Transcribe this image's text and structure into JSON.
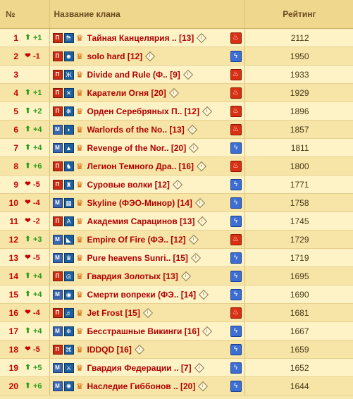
{
  "header": {
    "num": "№",
    "name": "Название клана",
    "rating": "Рейтинг"
  },
  "colors": {
    "rank": "#c40000",
    "up": "#2a9b1a",
    "down": "#c40000",
    "fire": "#d92f12",
    "storm": "#3c6ed6"
  },
  "rows": [
    {
      "place": "1",
      "dir": "up",
      "change": "+1",
      "badge": "П",
      "emblem": "⛈",
      "name": "Тайная Канцелярия .. [13]",
      "element": "fire",
      "rating": "2112"
    },
    {
      "place": "2",
      "dir": "down",
      "change": "-1",
      "badge": "П",
      "emblem": "☻",
      "name": "solo hard [12]",
      "element": "storm",
      "rating": "1950"
    },
    {
      "place": "3",
      "dir": "none",
      "change": "",
      "badge": "П",
      "emblem": "Ж",
      "name": "Divide and Rule (Ф.. [9]",
      "element": "fire",
      "rating": "1933"
    },
    {
      "place": "4",
      "dir": "up",
      "change": "+1",
      "badge": "П",
      "emblem": "✕",
      "name": "Каратели Огня [20]",
      "element": "fire",
      "rating": "1929"
    },
    {
      "place": "5",
      "dir": "up",
      "change": "+2",
      "badge": "П",
      "emblem": "❋",
      "name": "Орден Серебряных П.. [12]",
      "element": "fire",
      "rating": "1896"
    },
    {
      "place": "6",
      "dir": "up",
      "change": "+4",
      "badge": "М",
      "emblem": "◗",
      "name": "Warlords of the No.. [13]",
      "element": "fire",
      "rating": "1857"
    },
    {
      "place": "7",
      "dir": "up",
      "change": "+4",
      "badge": "М",
      "emblem": "▲",
      "name": "Revenge of the Nor.. [20]",
      "element": "storm",
      "rating": "1811"
    },
    {
      "place": "8",
      "dir": "up",
      "change": "+6",
      "badge": "П",
      "emblem": "♞",
      "name": "Легион Темного Дра.. [16]",
      "element": "fire",
      "rating": "1800"
    },
    {
      "place": "9",
      "dir": "down",
      "change": "-5",
      "badge": "П",
      "emblem": "♜",
      "name": "Суровые волки [12]",
      "element": "storm",
      "rating": "1771"
    },
    {
      "place": "10",
      "dir": "down",
      "change": "-4",
      "badge": "М",
      "emblem": "▦",
      "name": "Skyline (ФЭО-Минор) [14]",
      "element": "storm",
      "rating": "1758"
    },
    {
      "place": "11",
      "dir": "down",
      "change": "-2",
      "badge": "П",
      "emblem": "A",
      "name": "Академия Сарацинов [13]",
      "element": "storm",
      "rating": "1745"
    },
    {
      "place": "12",
      "dir": "up",
      "change": "+3",
      "badge": "М",
      "emblem": "◣",
      "name": "Empire Of Fire (ФЭ.. [12]",
      "element": "fire",
      "rating": "1729"
    },
    {
      "place": "13",
      "dir": "down",
      "change": "-5",
      "badge": "М",
      "emblem": "♛",
      "name": "Pure heavens Sunri.. [15]",
      "element": "storm",
      "rating": "1719"
    },
    {
      "place": "14",
      "dir": "up",
      "change": "+4",
      "badge": "П",
      "emblem": "◎",
      "name": "Гвардия Золотых  [13]",
      "element": "storm",
      "rating": "1695"
    },
    {
      "place": "15",
      "dir": "up",
      "change": "+4",
      "badge": "М",
      "emblem": "◉",
      "name": "Смерти вопреки (ФЭ.. [14]",
      "element": "storm",
      "rating": "1690"
    },
    {
      "place": "16",
      "dir": "down",
      "change": "-4",
      "badge": "П",
      "emblem": "♬",
      "name": "Jet Frost [15]",
      "element": "fire",
      "rating": "1681"
    },
    {
      "place": "17",
      "dir": "up",
      "change": "+4",
      "badge": "М",
      "emblem": "❄",
      "name": "Бесстрашные Викинги [16]",
      "element": "storm",
      "rating": "1667"
    },
    {
      "place": "18",
      "dir": "down",
      "change": "-5",
      "badge": "П",
      "emblem": "⌘",
      "name": "IDDQD [16]",
      "element": "storm",
      "rating": "1659"
    },
    {
      "place": "19",
      "dir": "up",
      "change": "+5",
      "badge": "М",
      "emblem": "⚔",
      "name": "Гвардия Федерации .. [7]",
      "element": "storm",
      "rating": "1652"
    },
    {
      "place": "20",
      "dir": "up",
      "change": "+6",
      "badge": "М",
      "emblem": "✺",
      "name": "Наследие Гиббонов .. [20]",
      "element": "storm",
      "rating": "1644"
    }
  ]
}
